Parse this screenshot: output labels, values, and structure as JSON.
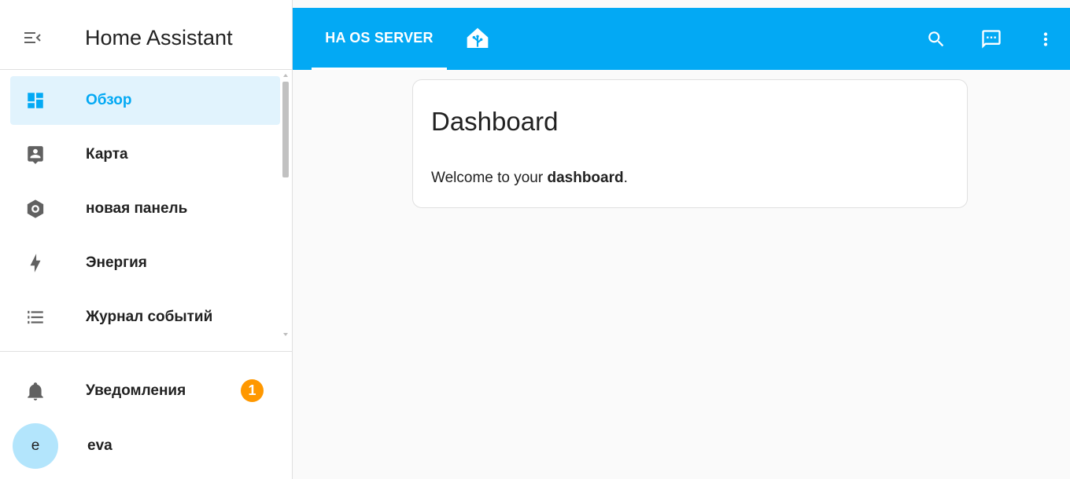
{
  "sidebar": {
    "title": "Home Assistant",
    "items": [
      {
        "label": "Обзор",
        "icon": "view-dashboard-icon",
        "active": true
      },
      {
        "label": "Карта",
        "icon": "map-account-icon",
        "active": false
      },
      {
        "label": "новая панель",
        "icon": "cog-icon",
        "active": false
      },
      {
        "label": "Энергия",
        "icon": "lightning-bolt-icon",
        "active": false
      },
      {
        "label": "Журнал событий",
        "icon": "format-list-icon",
        "active": false
      }
    ],
    "notifications": {
      "label": "Уведомления",
      "badge": "1",
      "icon": "bell-icon"
    },
    "user": {
      "initial": "e",
      "name": "eva"
    }
  },
  "topbar": {
    "tab_label": "HA OS SERVER",
    "logo_icon": "home-assistant-logo-icon",
    "actions": [
      "search-icon",
      "assist-chat-icon",
      "more-vert-icon"
    ]
  },
  "card": {
    "title": "Dashboard",
    "text_prefix": "Welcome to your ",
    "text_bold": "dashboard",
    "text_suffix": "."
  },
  "colors": {
    "primary": "#03a9f4",
    "active_bg": "#e1f3fd",
    "badge": "#ff9800",
    "avatar": "#b3e5fc"
  }
}
